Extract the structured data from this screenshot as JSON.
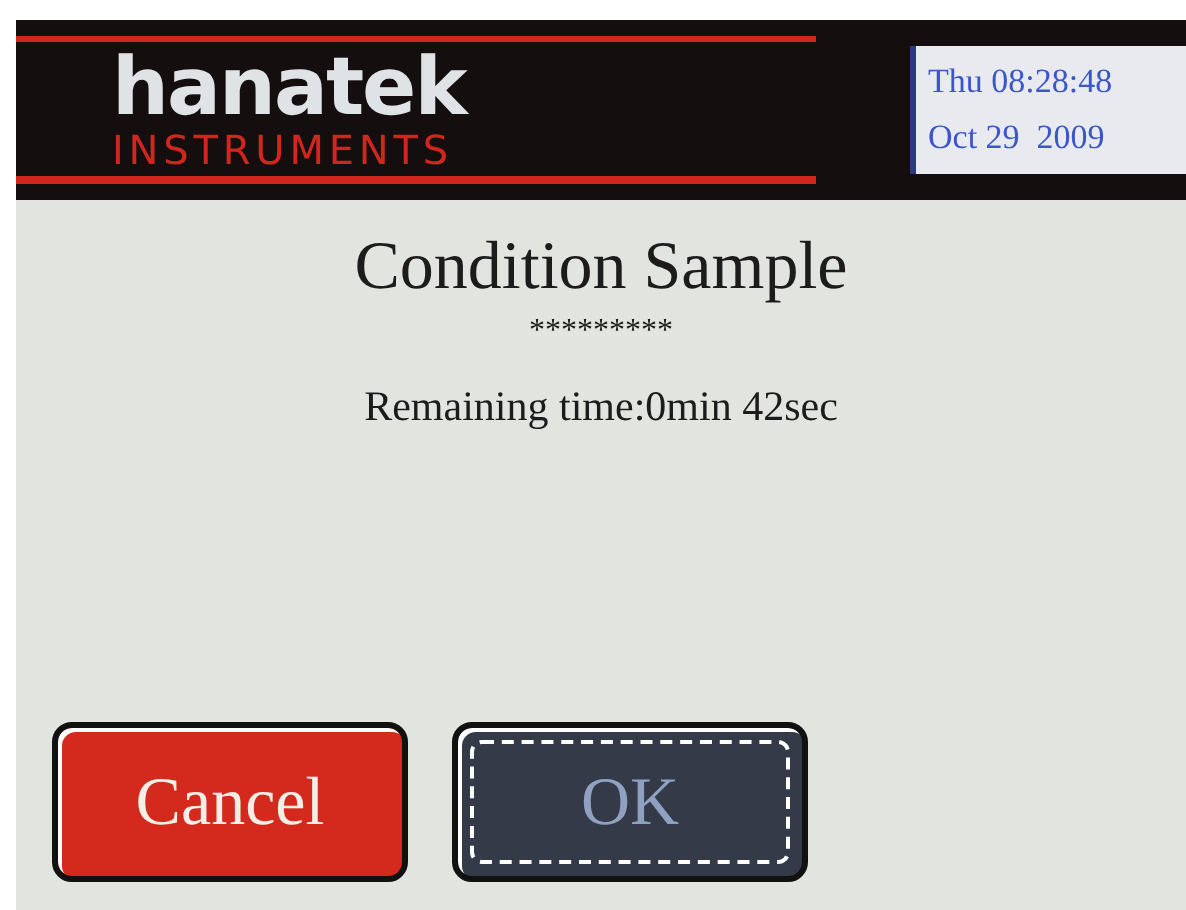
{
  "header": {
    "brand": "hanatek",
    "subtitle": "INSTRUMENTS",
    "clock": {
      "time": "Thu 08:28:48",
      "date": "Oct 29  2009"
    }
  },
  "title": "Condition Sample",
  "stars": "*********",
  "status": "Remaining time:0min 42sec",
  "buttons": [
    {
      "label": "Cancel",
      "kind": "cancel",
      "focused": false
    },
    {
      "label": "OK",
      "kind": "ok",
      "focused": true
    }
  ]
}
